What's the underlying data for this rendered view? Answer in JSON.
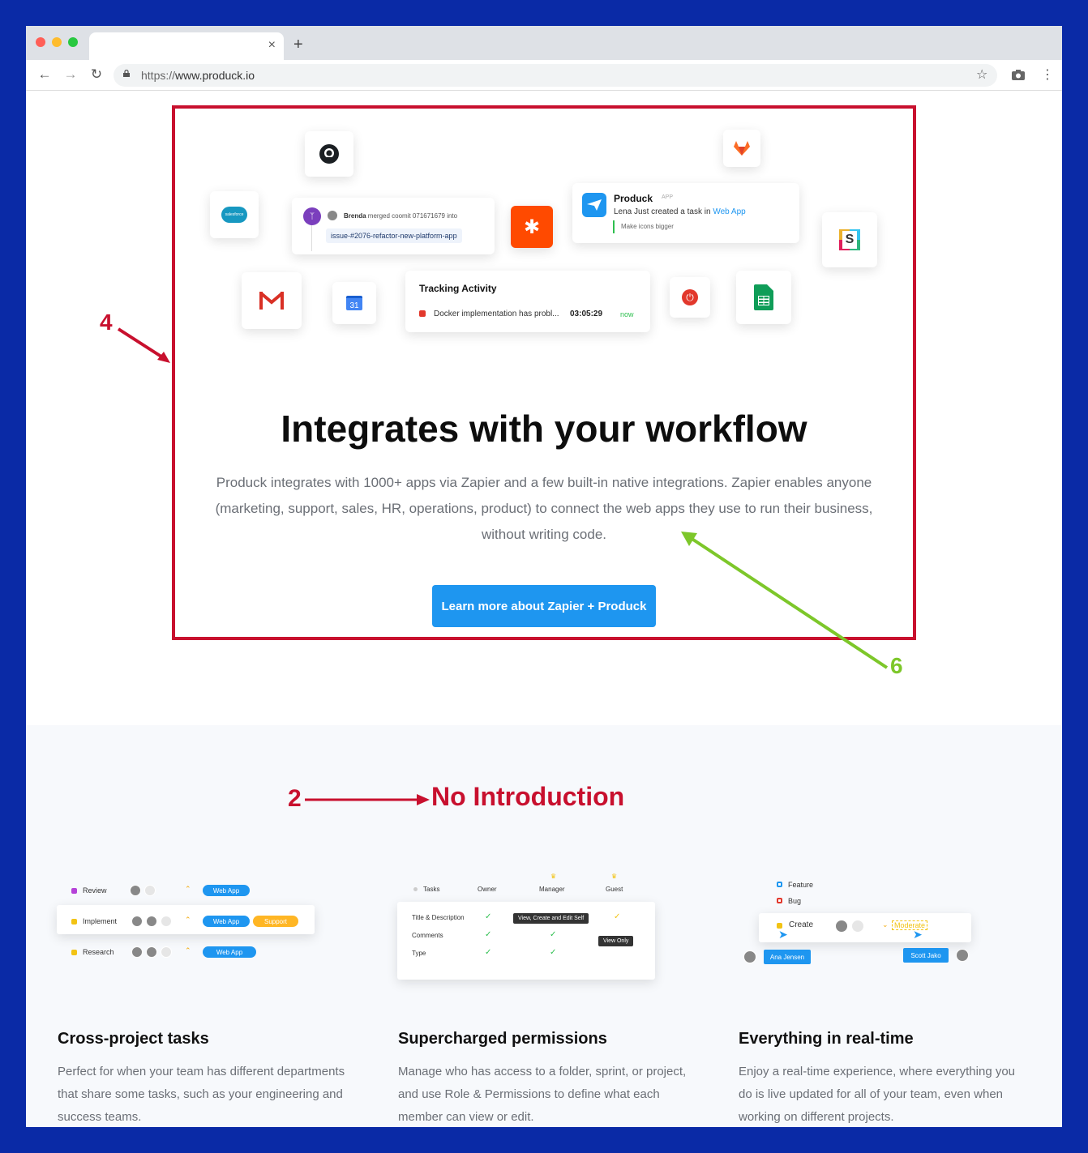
{
  "browser": {
    "url_prefix": "https://",
    "url_host": "www.produck.io",
    "tab_close": "×",
    "new_tab": "+"
  },
  "integration": {
    "merge_card": {
      "user": "Brenda",
      "action": "merged coomit 071671679 into",
      "branch": "issue-#2076-refactor-new-platform-app"
    },
    "notify_card": {
      "title": "Produck",
      "badge": "APP",
      "text_before": "Lena Just created a task in",
      "link": "Web App",
      "subtext": "Make icons bigger"
    },
    "tracking_card": {
      "title": "Tracking Activity",
      "task": "Docker implementation has probl...",
      "time": "03:05:29",
      "status": "now"
    },
    "calendar_day": "31",
    "salesforce_label": "salesforce",
    "headline": "Integrates with your workflow",
    "paragraph": "Produck integrates with 1000+ apps via Zapier and a few built-in native integrations. Zapier enables anyone (marketing, support, sales, HR, operations, product) to connect the web apps they use to run their business, without writing code.",
    "cta_label": "Learn more about Zapier + Produck"
  },
  "annotations": {
    "four": "4",
    "six": "6",
    "two": "2",
    "no_intro": "No Introduction"
  },
  "colors": {
    "annotation_red": "#c8102e",
    "annotation_green": "#7dc72a",
    "cta_blue": "#1e96f0",
    "frame_blue": "#0a2aa6"
  },
  "features": [
    {
      "title": "Cross-project tasks",
      "desc": "Perfect for when your team has different departments that share some tasks, such as your engineering and success teams.",
      "rows": [
        {
          "label": "Review",
          "tags": [
            "Web App"
          ]
        },
        {
          "label": "Implement",
          "tags": [
            "Web App",
            "Support"
          ]
        },
        {
          "label": "Research",
          "tags": [
            "Web App"
          ]
        }
      ]
    },
    {
      "title": "Supercharged permissions",
      "desc": "Manage who has access to a folder, sprint, or project, and use Role & Permissions to define what each member can view or edit.",
      "columns": [
        "Tasks",
        "Owner",
        "Manager",
        "Guest"
      ],
      "rows": [
        "Title & Description",
        "Comments",
        "Type"
      ],
      "tooltip_edit": "View, Create and Edit Self",
      "tooltip_view": "View Only",
      "check": "✓"
    },
    {
      "title": "Everything in real-time",
      "desc": "Enjoy a real-time experience, where everything you do is live updated for all of your team, even when working on different projects.",
      "types": [
        "Feature",
        "Bug",
        "Create"
      ],
      "priority": "Moderate",
      "user_left": "Ana Jensen",
      "user_right": "Scott Jako"
    }
  ]
}
